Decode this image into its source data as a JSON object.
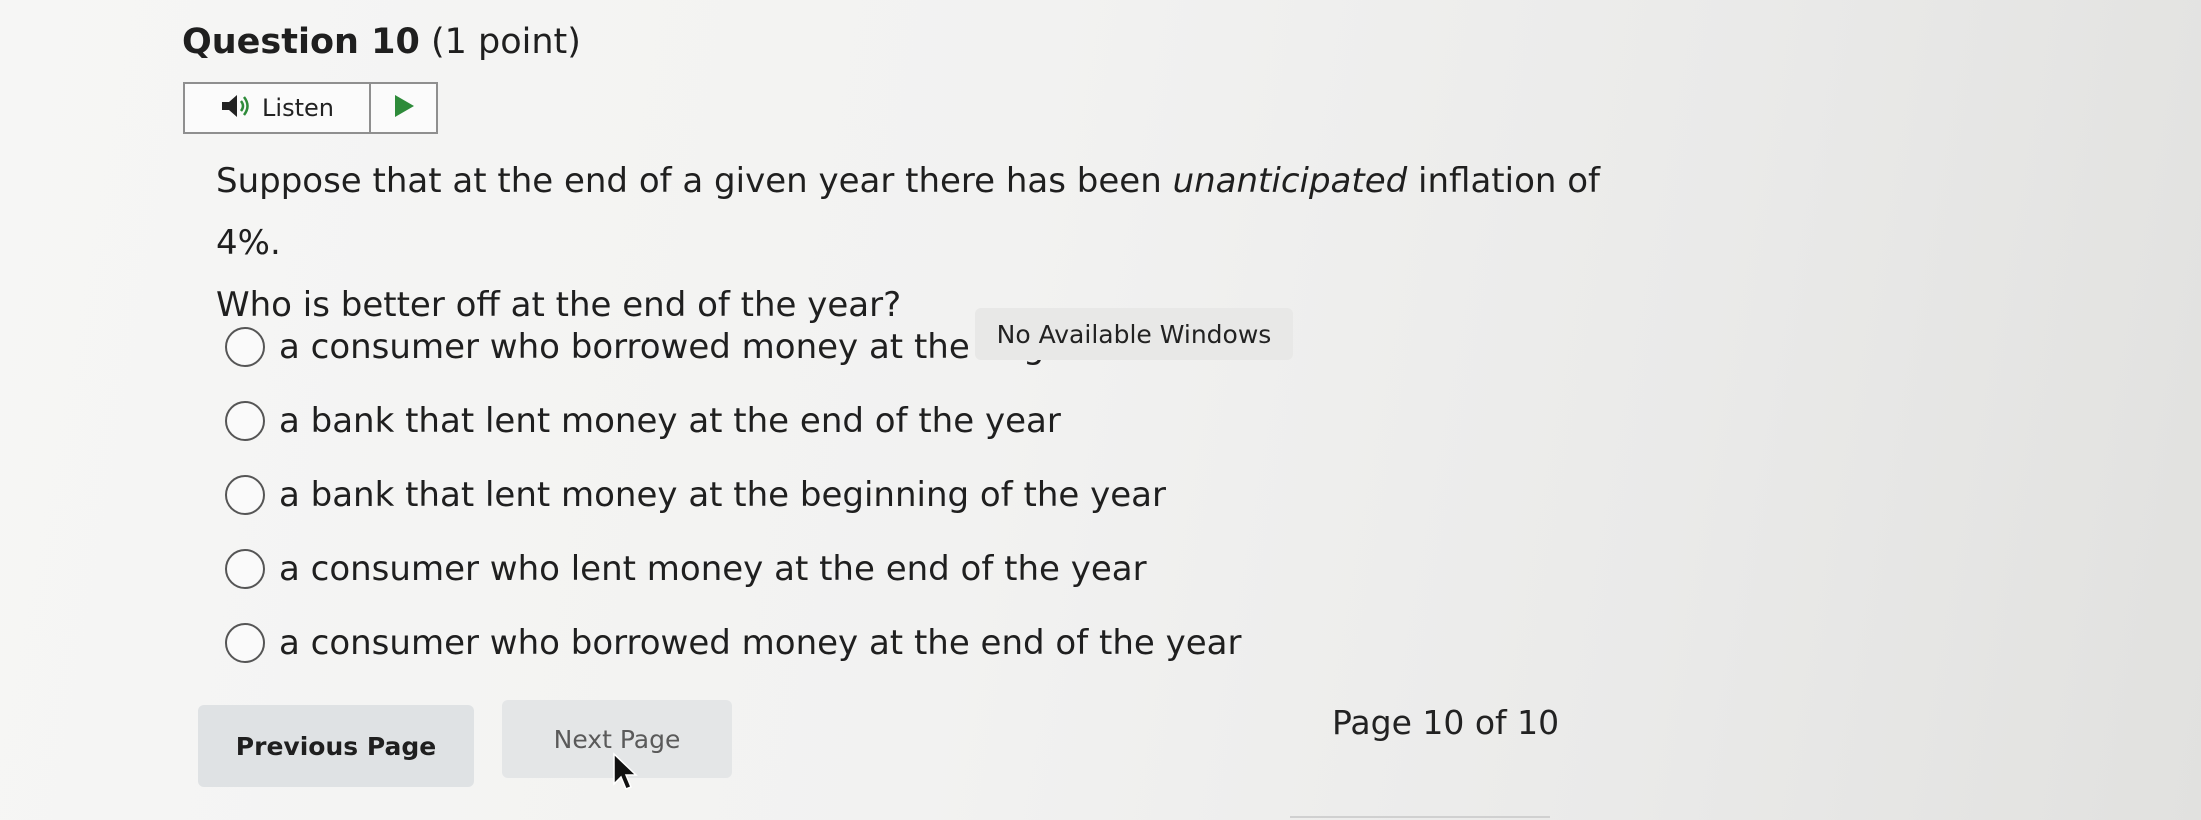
{
  "question": {
    "number_label": "Question 10",
    "points_label": "(1 point)",
    "prompt_before": "Suppose that at the end of a given year there has been ",
    "prompt_emphasis": "unanticipated",
    "prompt_after": " inflation of 4%.",
    "prompt_line2": "Who is better off at the end of the year?"
  },
  "listen": {
    "label": "Listen",
    "speaker_icon": "speaker-icon",
    "play_icon": "play-icon",
    "accent_color": "#2e8b3a"
  },
  "options": [
    {
      "label": "a consumer who borrowed money at the beg"
    },
    {
      "label": "a bank that lent money at the end of the year"
    },
    {
      "label": "a bank that lent money at the beginning of the year"
    },
    {
      "label": "a consumer who lent money at the end of the year"
    },
    {
      "label": "a consumer who borrowed money at the end of the year"
    }
  ],
  "tooltip": {
    "text": "No Available Windows"
  },
  "navigation": {
    "previous_label": "Previous Page",
    "next_label": "Next Page",
    "page_indicator": "Page 10 of 10"
  }
}
